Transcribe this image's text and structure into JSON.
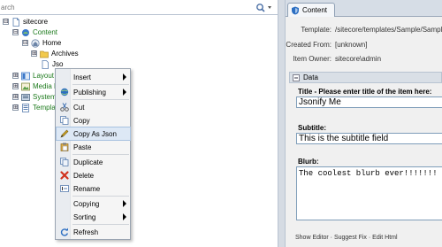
{
  "search": {
    "placeholder": "arch"
  },
  "tree": {
    "items": [
      {
        "label": "sitecore",
        "toggle": "⊟"
      },
      {
        "label": "Content",
        "toggle": "⊟"
      },
      {
        "label": "Home",
        "toggle": "⊟"
      },
      {
        "label": "Archives",
        "toggle": "⊞"
      },
      {
        "label": "Jso"
      },
      {
        "label": "Layout",
        "toggle": "⊞"
      },
      {
        "label": "Media Li",
        "toggle": "⊞"
      },
      {
        "label": "System",
        "toggle": "⊞"
      },
      {
        "label": "Templat",
        "toggle": "⊞"
      }
    ]
  },
  "context_menu": {
    "items": [
      {
        "label": "Insert",
        "submenu": true
      },
      {
        "label": "Publishing",
        "submenu": true
      },
      {
        "label": "Cut"
      },
      {
        "label": "Copy"
      },
      {
        "label": "Copy As Json",
        "highlighted": true
      },
      {
        "label": "Paste"
      },
      {
        "label": "Duplicate"
      },
      {
        "label": "Delete"
      },
      {
        "label": "Rename"
      },
      {
        "label": "Copying",
        "submenu": true
      },
      {
        "label": "Sorting",
        "submenu": true
      },
      {
        "label": "Refresh"
      }
    ]
  },
  "editor": {
    "tab_label": "Content",
    "template_label": "Template:",
    "template_value": "/sitecore/templates/Sample/Sample",
    "created_from_label": "Created From:",
    "created_from_value": "[unknown]",
    "owner_label": "Item Owner:",
    "owner_value": "sitecore\\admin",
    "section_title": "Data",
    "fields": {
      "title_label": "Title - Please enter title of the item here:",
      "title_value": "Jsonify Me",
      "subtitle_label": "Subtitle:",
      "subtitle_value": "This is the subtitle field",
      "blurb_label": "Blurb:",
      "blurb_value": "The coolest blurb ever!!!!!!!"
    },
    "footer_links": "Show Editor · Suggest Fix · Edit Html"
  },
  "colors": {
    "accent": "#dde8f5",
    "green_text": "#1c7a1c",
    "border": "#7f9db9"
  }
}
